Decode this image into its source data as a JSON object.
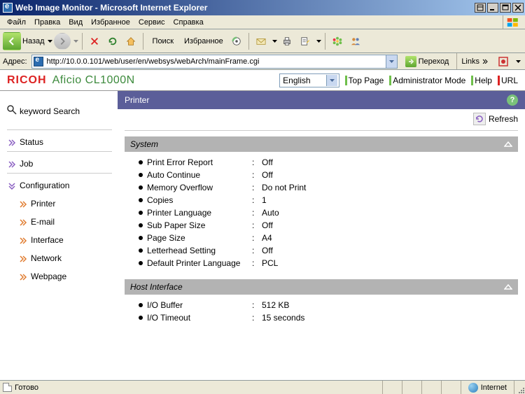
{
  "window": {
    "title": "Web Image Monitor - Microsoft Internet Explorer"
  },
  "menubar": [
    "Файл",
    "Правка",
    "Вид",
    "Избранное",
    "Сервис",
    "Справка"
  ],
  "toolbar": {
    "back": "Назад",
    "search": "Поиск",
    "favorites": "Избранное"
  },
  "addressbar": {
    "label": "Адрес:",
    "url": "http://10.0.0.101/web/user/en/websys/webArch/mainFrame.cgi",
    "go": "Переход",
    "links": "Links"
  },
  "ricoh": {
    "logo": "RICOH",
    "model": "Aficio CL1000N",
    "language": "English",
    "links": {
      "top": "Top Page",
      "admin": "Administrator Mode",
      "help": "Help",
      "url": "URL"
    }
  },
  "leftnav": {
    "keyword_search": "keyword Search",
    "status": "Status",
    "job": "Job",
    "config": "Configuration",
    "sub": [
      "Printer",
      "E-mail",
      "Interface",
      "Network",
      "Webpage"
    ]
  },
  "panel": {
    "title": "Printer",
    "refresh": "Refresh",
    "sections": {
      "system": {
        "title": "System",
        "rows": [
          {
            "k": "Print Error Report",
            "v": "Off"
          },
          {
            "k": "Auto Continue",
            "v": "Off"
          },
          {
            "k": "Memory Overflow",
            "v": "Do not Print"
          },
          {
            "k": "Copies",
            "v": "1"
          },
          {
            "k": "Printer Language",
            "v": "Auto"
          },
          {
            "k": "Sub Paper Size",
            "v": "Off"
          },
          {
            "k": "Page Size",
            "v": "A4"
          },
          {
            "k": "Letterhead Setting",
            "v": "Off"
          },
          {
            "k": "Default Printer Language",
            "v": "PCL"
          }
        ]
      },
      "host": {
        "title": "Host Interface",
        "rows": [
          {
            "k": "I/O Buffer",
            "v": "512 KB"
          },
          {
            "k": "I/O Timeout",
            "v": "15 seconds"
          }
        ]
      }
    }
  },
  "statusbar": {
    "ready": "Готово",
    "zone": "Internet"
  }
}
